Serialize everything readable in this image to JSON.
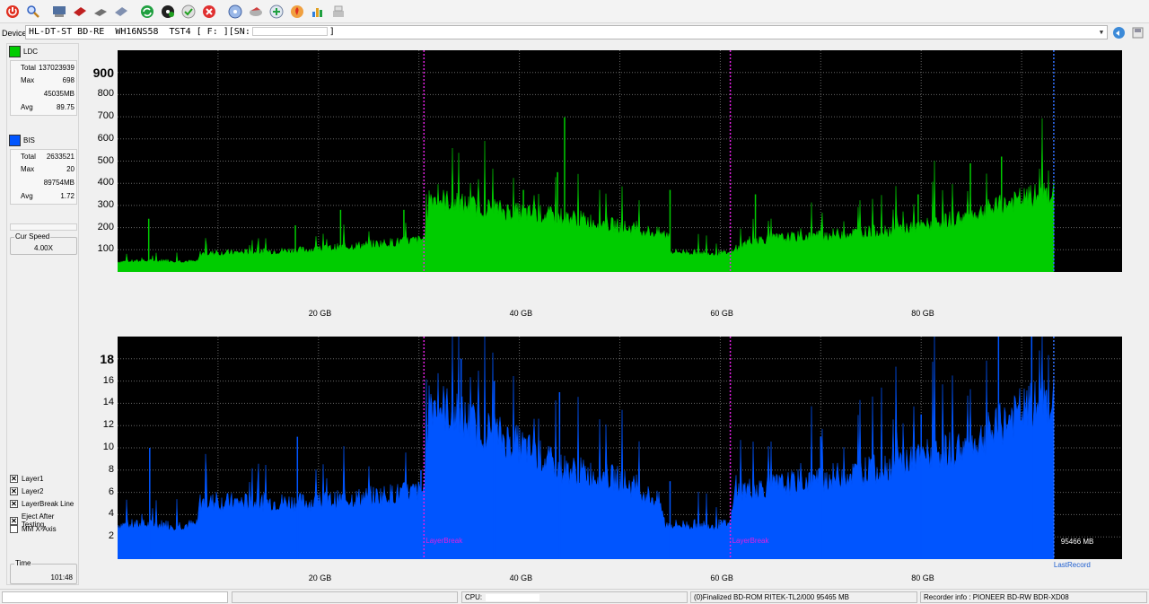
{
  "toolbar": {
    "icons": [
      "power-icon",
      "search-icon",
      "drive-info-icon",
      "erase-icon",
      "disc-copy-icon",
      "disc-write-icon",
      "refresh-icon",
      "disc-scan-icon",
      "write-check-icon",
      "stop-icon",
      "disc-blue-icon",
      "disc-erase-icon",
      "quality-icon",
      "burn-icon",
      "chart-icon",
      "settings-icon"
    ]
  },
  "device": {
    "label": "Device:",
    "value": "HL-DT-ST BD-RE  WH16NS58  TST4 [ F: ][SN:",
    "suffix": "]"
  },
  "ldc": {
    "label": "LDC",
    "color": "#00cc00",
    "total_label": "Total",
    "total": "137023939",
    "max_label": "Max",
    "max": "698",
    "max_pos": "45035MB",
    "avg_label": "Avg",
    "avg": "89.75"
  },
  "bis": {
    "label": "BIS",
    "color": "#0055ff",
    "total_label": "Total",
    "total": "2633521",
    "max_label": "Max",
    "max": "20",
    "max_pos": "89754MB",
    "avg_label": "Avg",
    "avg": "1.72"
  },
  "speed": {
    "label": "Cur Speed",
    "value": "4.00X"
  },
  "options": [
    {
      "label": "Layer1",
      "checked": true
    },
    {
      "label": "Layer2",
      "checked": true
    },
    {
      "label": "LayerBreak Line",
      "checked": true
    },
    {
      "label": "Eject After Testing",
      "checked": true
    },
    {
      "label": "MM X-Axis",
      "checked": false
    }
  ],
  "time": {
    "label": "Time",
    "value": "101:48"
  },
  "chart_data": [
    {
      "type": "area",
      "name": "LDC",
      "x_unit": "GB",
      "xlim": [
        0,
        100
      ],
      "ylim": [
        0,
        1000
      ],
      "y_ticks": [
        "900",
        "800",
        "700",
        "600",
        "500",
        "400",
        "300",
        "200",
        "100"
      ],
      "x_ticks": [
        "20 GB",
        "40 GB",
        "60 GB",
        "80 GB"
      ],
      "layer_breaks_gb": [
        30.5,
        61.0
      ],
      "end_gb": 93.2,
      "series_color": "#00cc00",
      "baseline": [
        [
          0,
          45
        ],
        [
          5,
          50
        ],
        [
          8,
          45
        ],
        [
          8.2,
          80
        ],
        [
          15,
          90
        ],
        [
          20,
          100
        ],
        [
          25,
          120
        ],
        [
          30,
          140
        ],
        [
          30.6,
          150
        ],
        [
          31,
          330
        ],
        [
          34,
          300
        ],
        [
          40,
          260
        ],
        [
          45,
          240
        ],
        [
          50,
          200
        ],
        [
          55,
          160
        ],
        [
          54.3,
          150
        ],
        [
          54.4,
          90
        ],
        [
          61,
          80
        ],
        [
          61.5,
          95
        ],
        [
          63,
          140
        ],
        [
          70,
          160
        ],
        [
          76,
          180
        ],
        [
          80,
          200
        ],
        [
          85,
          250
        ],
        [
          90,
          320
        ],
        [
          93.2,
          350
        ]
      ],
      "spikes": [
        [
          3.1,
          240
        ],
        [
          17.7,
          210
        ],
        [
          22.2,
          280
        ],
        [
          28.5,
          280
        ],
        [
          40.4,
          370
        ],
        [
          43.8,
          450
        ],
        [
          55.0,
          370
        ],
        [
          63.5,
          350
        ],
        [
          79.7,
          350
        ],
        [
          84.9,
          490
        ],
        [
          88.0,
          520
        ]
      ],
      "max_annotation": {
        "x": 44.5,
        "y": 698
      }
    },
    {
      "type": "area",
      "name": "BIS",
      "x_unit": "GB",
      "xlim": [
        0,
        100
      ],
      "ylim": [
        0,
        20
      ],
      "y_ticks": [
        "18",
        "16",
        "14",
        "12",
        "10",
        "8",
        "6",
        "4",
        "2"
      ],
      "x_ticks": [
        "20 GB",
        "40 GB",
        "60 GB",
        "80 GB"
      ],
      "layer_breaks_gb": [
        30.5,
        61.0
      ],
      "end_gb": 93.2,
      "series_color": "#0055ff",
      "baseline": [
        [
          0,
          3
        ],
        [
          8,
          3
        ],
        [
          8.1,
          5
        ],
        [
          20,
          5
        ],
        [
          30.5,
          6
        ],
        [
          31,
          14
        ],
        [
          35,
          12
        ],
        [
          40,
          10
        ],
        [
          44,
          8
        ],
        [
          50,
          7
        ],
        [
          54,
          5
        ],
        [
          54.5,
          3
        ],
        [
          61,
          3
        ],
        [
          61.5,
          6
        ],
        [
          70,
          7
        ],
        [
          76,
          8
        ],
        [
          80,
          9
        ],
        [
          85,
          10
        ],
        [
          90,
          13
        ],
        [
          93.2,
          14
        ]
      ],
      "spikes": [
        [
          3.2,
          10
        ],
        [
          17.9,
          11
        ],
        [
          30.2,
          8
        ],
        [
          34.2,
          18
        ],
        [
          37.5,
          16
        ],
        [
          44.0,
          15
        ],
        [
          55.0,
          7
        ],
        [
          70.0,
          11
        ],
        [
          75.0,
          9
        ],
        [
          80.0,
          13
        ],
        [
          87.7,
          20
        ],
        [
          91.0,
          20
        ]
      ],
      "layer_break_label": "LayerBreak",
      "end_size_label": "95466 MB",
      "last_record_label": "LastRecord"
    }
  ],
  "status": {
    "cpu_label": "CPU:",
    "disc_info": "(0)Finalized   BD-ROM   RITEK-TL2/000   95465 MB",
    "recorder_info": "Recorder info : PIONEER       BD-RW    BDR-XD08"
  }
}
